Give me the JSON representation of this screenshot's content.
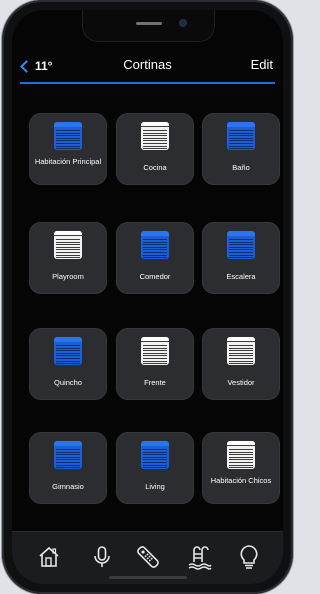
{
  "header": {
    "back_icon": "chevron-left-icon",
    "temperature": "11°",
    "title": "Cortinas",
    "edit_label": "Edit"
  },
  "colors": {
    "accent": "#2e8cff",
    "blind_active": "#1c5fd4",
    "blind_inactive": "#f2f2f2",
    "tile_bg": "#2b2d31"
  },
  "tiles": [
    {
      "label": "Habitación Principal",
      "state": "active"
    },
    {
      "label": "Cocina",
      "state": "inactive"
    },
    {
      "label": "Baño",
      "state": "active"
    },
    {
      "label": "Playroom",
      "state": "inactive"
    },
    {
      "label": "Comedor",
      "state": "active"
    },
    {
      "label": "Escalera",
      "state": "active"
    },
    {
      "label": "Quincho",
      "state": "active"
    },
    {
      "label": "Frente",
      "state": "inactive"
    },
    {
      "label": "Vestidor",
      "state": "inactive"
    },
    {
      "label": "Gimnasio",
      "state": "active"
    },
    {
      "label": "Living",
      "state": "active"
    },
    {
      "label": "Habitación Chicos",
      "state": "inactive"
    }
  ],
  "tabbar": {
    "items": [
      {
        "icon": "home-icon"
      },
      {
        "icon": "microphone-icon"
      },
      {
        "icon": "remote-control-icon"
      },
      {
        "icon": "pool-icon"
      },
      {
        "icon": "light-bulb-icon"
      }
    ]
  }
}
